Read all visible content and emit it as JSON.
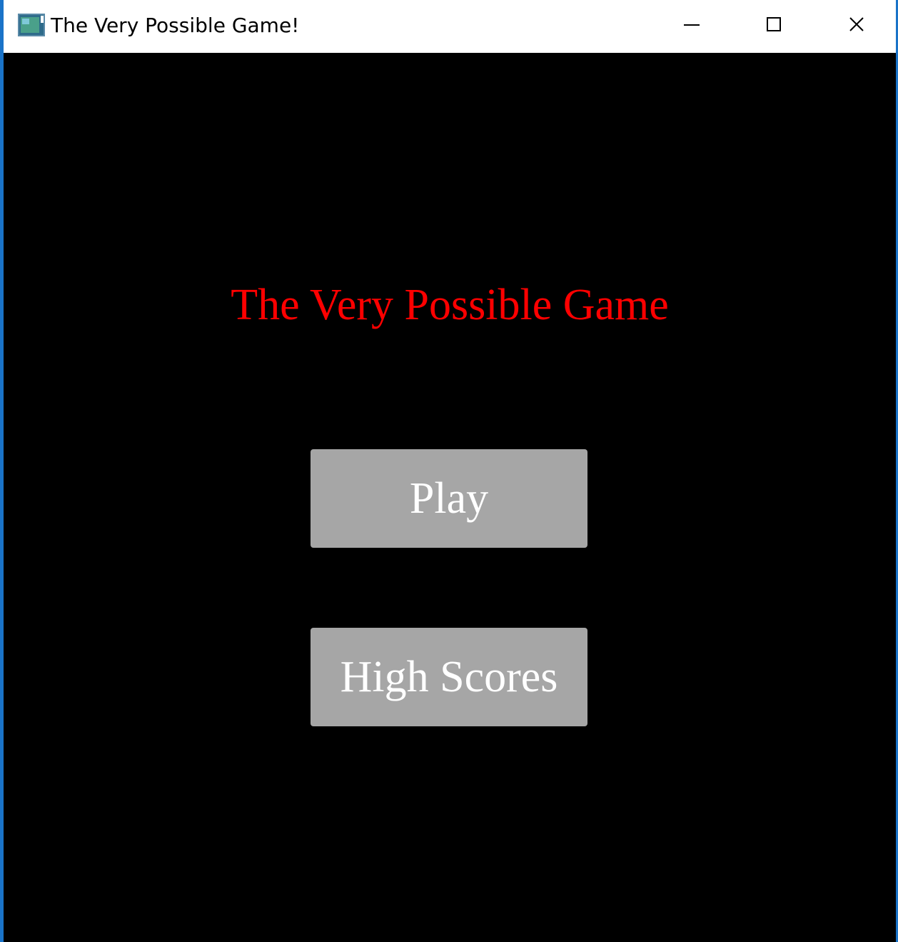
{
  "window": {
    "title": "The Very Possible Game!",
    "controls": {
      "minimize_icon": "minimize-icon",
      "maximize_icon": "maximize-icon",
      "close_icon": "close-icon"
    },
    "border_color": "#1a73c8"
  },
  "game": {
    "title": "The Very Possible Game",
    "title_color": "#ff0000",
    "background_color": "#000000"
  },
  "menu": {
    "play_label": "Play",
    "highscores_label": "High Scores",
    "button_color": "#a6a6a6",
    "button_text_color": "#ffffff"
  }
}
